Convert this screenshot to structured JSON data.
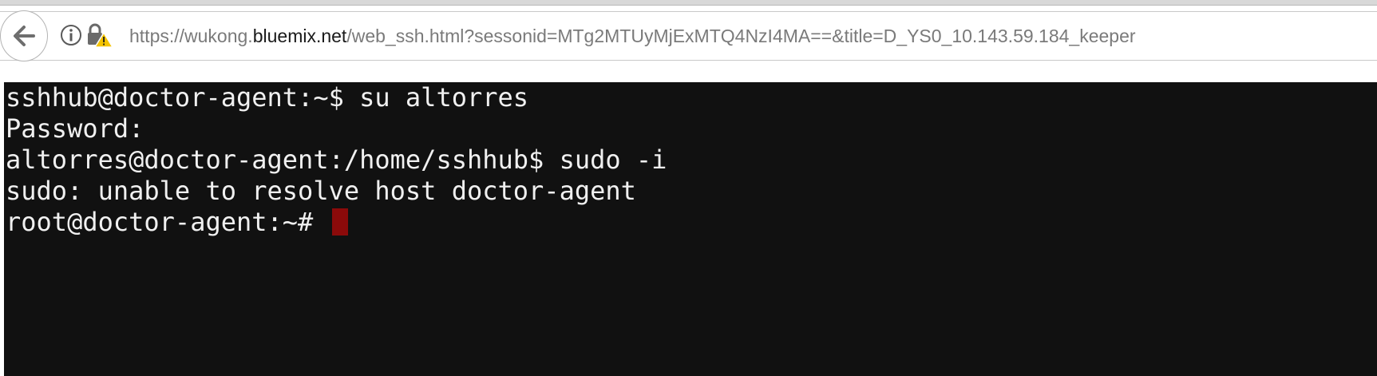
{
  "browser": {
    "url_prefix": "https://wukong.",
    "url_domain": "bluemix.net",
    "url_path": "/web_ssh.html?sessonid=MTg2MTUyMjExMTQ4NzI4MA==&title=D_YS0_10.143.59.184_keeper",
    "icons": {
      "back": "back-arrow-icon",
      "info": "info-icon",
      "lock_warning": "lock-warning-icon"
    },
    "colors": {
      "url_text": "#7a7a7a",
      "url_domain": "#1a1a1a",
      "warning": "#f5c400"
    }
  },
  "terminal": {
    "lines": [
      "sshhub@doctor-agent:~$ su altorres",
      "Password:",
      "altorres@doctor-agent:/home/sshhub$ sudo -i",
      "sudo: unable to resolve host doctor-agent",
      "root@doctor-agent:~# "
    ],
    "colors": {
      "background": "#111111",
      "text": "#f0f0f0",
      "cursor": "#8b0a0a"
    }
  }
}
